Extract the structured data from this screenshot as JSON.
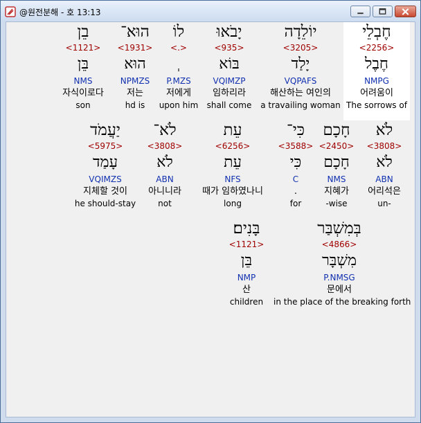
{
  "window": {
    "title": "@원전분해 - 호 13:13",
    "controls": {
      "minimize": "minimize-icon",
      "maximize": "maximize-icon",
      "close": "close-icon"
    }
  },
  "rows": [
    {
      "words": [
        {
          "heb": "חֶבְלֵי",
          "strong": "<2256>",
          "lemma": "חֶבֶל",
          "morph": "NMPG",
          "kor": "어려움이",
          "eng": "The sorrows of",
          "highlight": true
        },
        {
          "heb": "יוֹלֵדָה",
          "strong": "<3205>",
          "lemma": "יָלַד",
          "morph": "VQPAFS",
          "kor": "해산하는 여인의",
          "eng": "a travailing woman"
        },
        {
          "heb": "יָבֹאוּ",
          "strong": "<935>",
          "lemma": "בּוֹא",
          "morph": "VQIMZP",
          "kor": "임하리라",
          "eng": "shall come"
        },
        {
          "heb": "לוֹ",
          "strong": "<.>",
          "lemma": "ְ",
          "morph": "P.MZS",
          "kor": "저에게",
          "eng": "upon him"
        },
        {
          "heb": "הוּא־",
          "strong": "<1931>",
          "lemma": "הוּא",
          "morph": "NPMZS",
          "kor": "저는",
          "eng": "hd is"
        },
        {
          "heb": "בֵן",
          "strong": "<1121>",
          "lemma": "בֵּן",
          "morph": "NMS",
          "kor": "자식이로다",
          "eng": "son"
        }
      ]
    },
    {
      "words": [
        {
          "heb": "לֹא",
          "strong": "<3808>",
          "lemma": "לֹא",
          "morph": "ABN",
          "kor": "어리석은",
          "eng": "un-"
        },
        {
          "heb": "חָכָם",
          "strong": "<2450>",
          "lemma": "חָכָם",
          "morph": "NMS",
          "kor": "지혜가",
          "eng": "-wise"
        },
        {
          "heb": "כִּי־",
          "strong": "<3588>",
          "lemma": "כִּי",
          "morph": "C",
          "kor": ".",
          "eng": "for"
        },
        {
          "heb": "עֵת",
          "strong": "<6256>",
          "lemma": "עֵת",
          "morph": "NFS",
          "kor": "때가 임하였나니",
          "eng": "long"
        },
        {
          "heb": "לֹא־",
          "strong": "<3808>",
          "lemma": "לֹא",
          "morph": "ABN",
          "kor": "아니니라",
          "eng": "not"
        },
        {
          "heb": "יַעֲמֹד",
          "strong": "<5975>",
          "lemma": "עָמַד",
          "morph": "VQIMZS",
          "kor": "지체할 것이",
          "eng": "he should-stay"
        }
      ]
    },
    {
      "words": [
        {
          "heb": "בְּמִשְׁבַּר",
          "strong": "<4866>",
          "lemma": "מִשְׁבָּר",
          "morph": "P.NMSG",
          "kor": "문에서",
          "eng": "in the place of the breaking forth"
        },
        {
          "heb": "בָּנִים׃",
          "strong": "<1121>",
          "lemma": "בֵּן",
          "morph": "NMP",
          "kor": "산",
          "eng": "children"
        }
      ]
    }
  ]
}
